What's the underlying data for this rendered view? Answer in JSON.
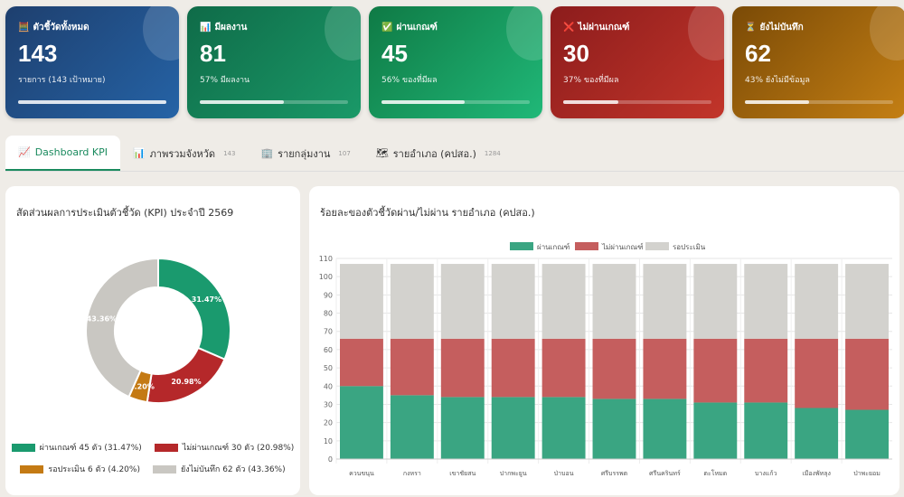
{
  "cards": [
    {
      "icon": "🧮",
      "label": "ตัวชี้วัดทั้งหมด",
      "value": "143",
      "sub": "รายการ (143 เป้าหมาย)",
      "progress": 100,
      "bg": "linear-gradient(135deg,#1e3f6e,#2563a6)"
    },
    {
      "icon": "📊",
      "label": "มีผลงาน",
      "value": "81",
      "sub": "57% มีผลงาน",
      "progress": 57,
      "bg": "linear-gradient(135deg,#0f6b48,#1a9968)"
    },
    {
      "icon": "✅",
      "label": "ผ่านเกณฑ์",
      "value": "45",
      "sub": "56% ของที่มีผล",
      "progress": 56,
      "bg": "linear-gradient(135deg,#0f7a45,#20b878)"
    },
    {
      "icon": "❌",
      "label": "ไม่ผ่านเกณฑ์",
      "value": "30",
      "sub": "37% ของที่มีผล",
      "progress": 37,
      "bg": "linear-gradient(135deg,#8c1c1c,#c2352a)"
    },
    {
      "icon": "⏳",
      "label": "ยังไม่บันทึก",
      "value": "62",
      "sub": "43% ยังไม่มีข้อมูล",
      "progress": 43,
      "bg": "linear-gradient(135deg,#7a4a06,#c47f14)"
    }
  ],
  "tabs": [
    {
      "icon": "📈",
      "label": "Dashboard KPI",
      "count": ""
    },
    {
      "icon": "📊",
      "label": "ภาพรวมจังหวัด",
      "count": "143"
    },
    {
      "icon": "🏢",
      "label": "รายกลุ่มงาน",
      "count": "107"
    },
    {
      "icon": "🗺",
      "label": "รายอำเภอ (คปสอ.)",
      "count": "1284"
    }
  ],
  "chart_data": [
    {
      "type": "pie",
      "title": "สัดส่วนผลการประเมินตัวชี้วัด (KPI) ประจำปี 2569",
      "slices": [
        {
          "label": "ผ่านเกณฑ์",
          "value": 45,
          "pct": "31.47%",
          "legend": "ผ่านเกณฑ์ 45 ตัว (31.47%)",
          "color": "#1a9a6e"
        },
        {
          "label": "ไม่ผ่านเกณฑ์",
          "value": 30,
          "pct": "20.98%",
          "legend": "ไม่ผ่านเกณฑ์ 30 ตัว (20.98%)",
          "color": "#b5282a"
        },
        {
          "label": "รอประเมิน",
          "value": 6,
          "pct": "4.20%",
          "legend": "รอประเมิน 6 ตัว (4.20%)",
          "color": "#c47a14"
        },
        {
          "label": "ยังไม่บันทึก",
          "value": 62,
          "pct": "43.36%",
          "legend": "ยังไม่บันทึก 62 ตัว (43.36%)",
          "color": "#c9c7c2"
        }
      ]
    },
    {
      "type": "bar",
      "stacked": true,
      "title": "ร้อยละของตัวชี้วัดผ่าน/ไม่ผ่าน รายอำเภอ (คปสอ.)",
      "categories": [
        "ควนขนุน",
        "กงหรา",
        "เขาชัยสน",
        "ปากพะยูน",
        "ป่าบอน",
        "ศรีบรรพต",
        "ศรีนครินทร์",
        "ตะโหมด",
        "บางแก้ว",
        "เมืองพัทลุง",
        "ป่าพะยอม"
      ],
      "series": [
        {
          "name": "ผ่านเกณฑ์",
          "color": "#3aa582",
          "values": [
            40,
            35,
            34,
            34,
            34,
            33,
            33,
            31,
            31,
            28,
            27
          ]
        },
        {
          "name": "ไม่ผ่านเกณฑ์",
          "color": "#c55e5e",
          "values": [
            26,
            31,
            32,
            32,
            32,
            33,
            33,
            35,
            35,
            38,
            39
          ]
        },
        {
          "name": "รอประเมิน",
          "color": "#d3d2ce",
          "values": [
            41,
            41,
            41,
            41,
            41,
            41,
            41,
            41,
            41,
            41,
            41
          ]
        }
      ],
      "ylim": [
        0,
        110
      ],
      "yticks": [
        0,
        10,
        20,
        30,
        40,
        50,
        60,
        70,
        80,
        90,
        100,
        110
      ],
      "legend": "top"
    }
  ]
}
